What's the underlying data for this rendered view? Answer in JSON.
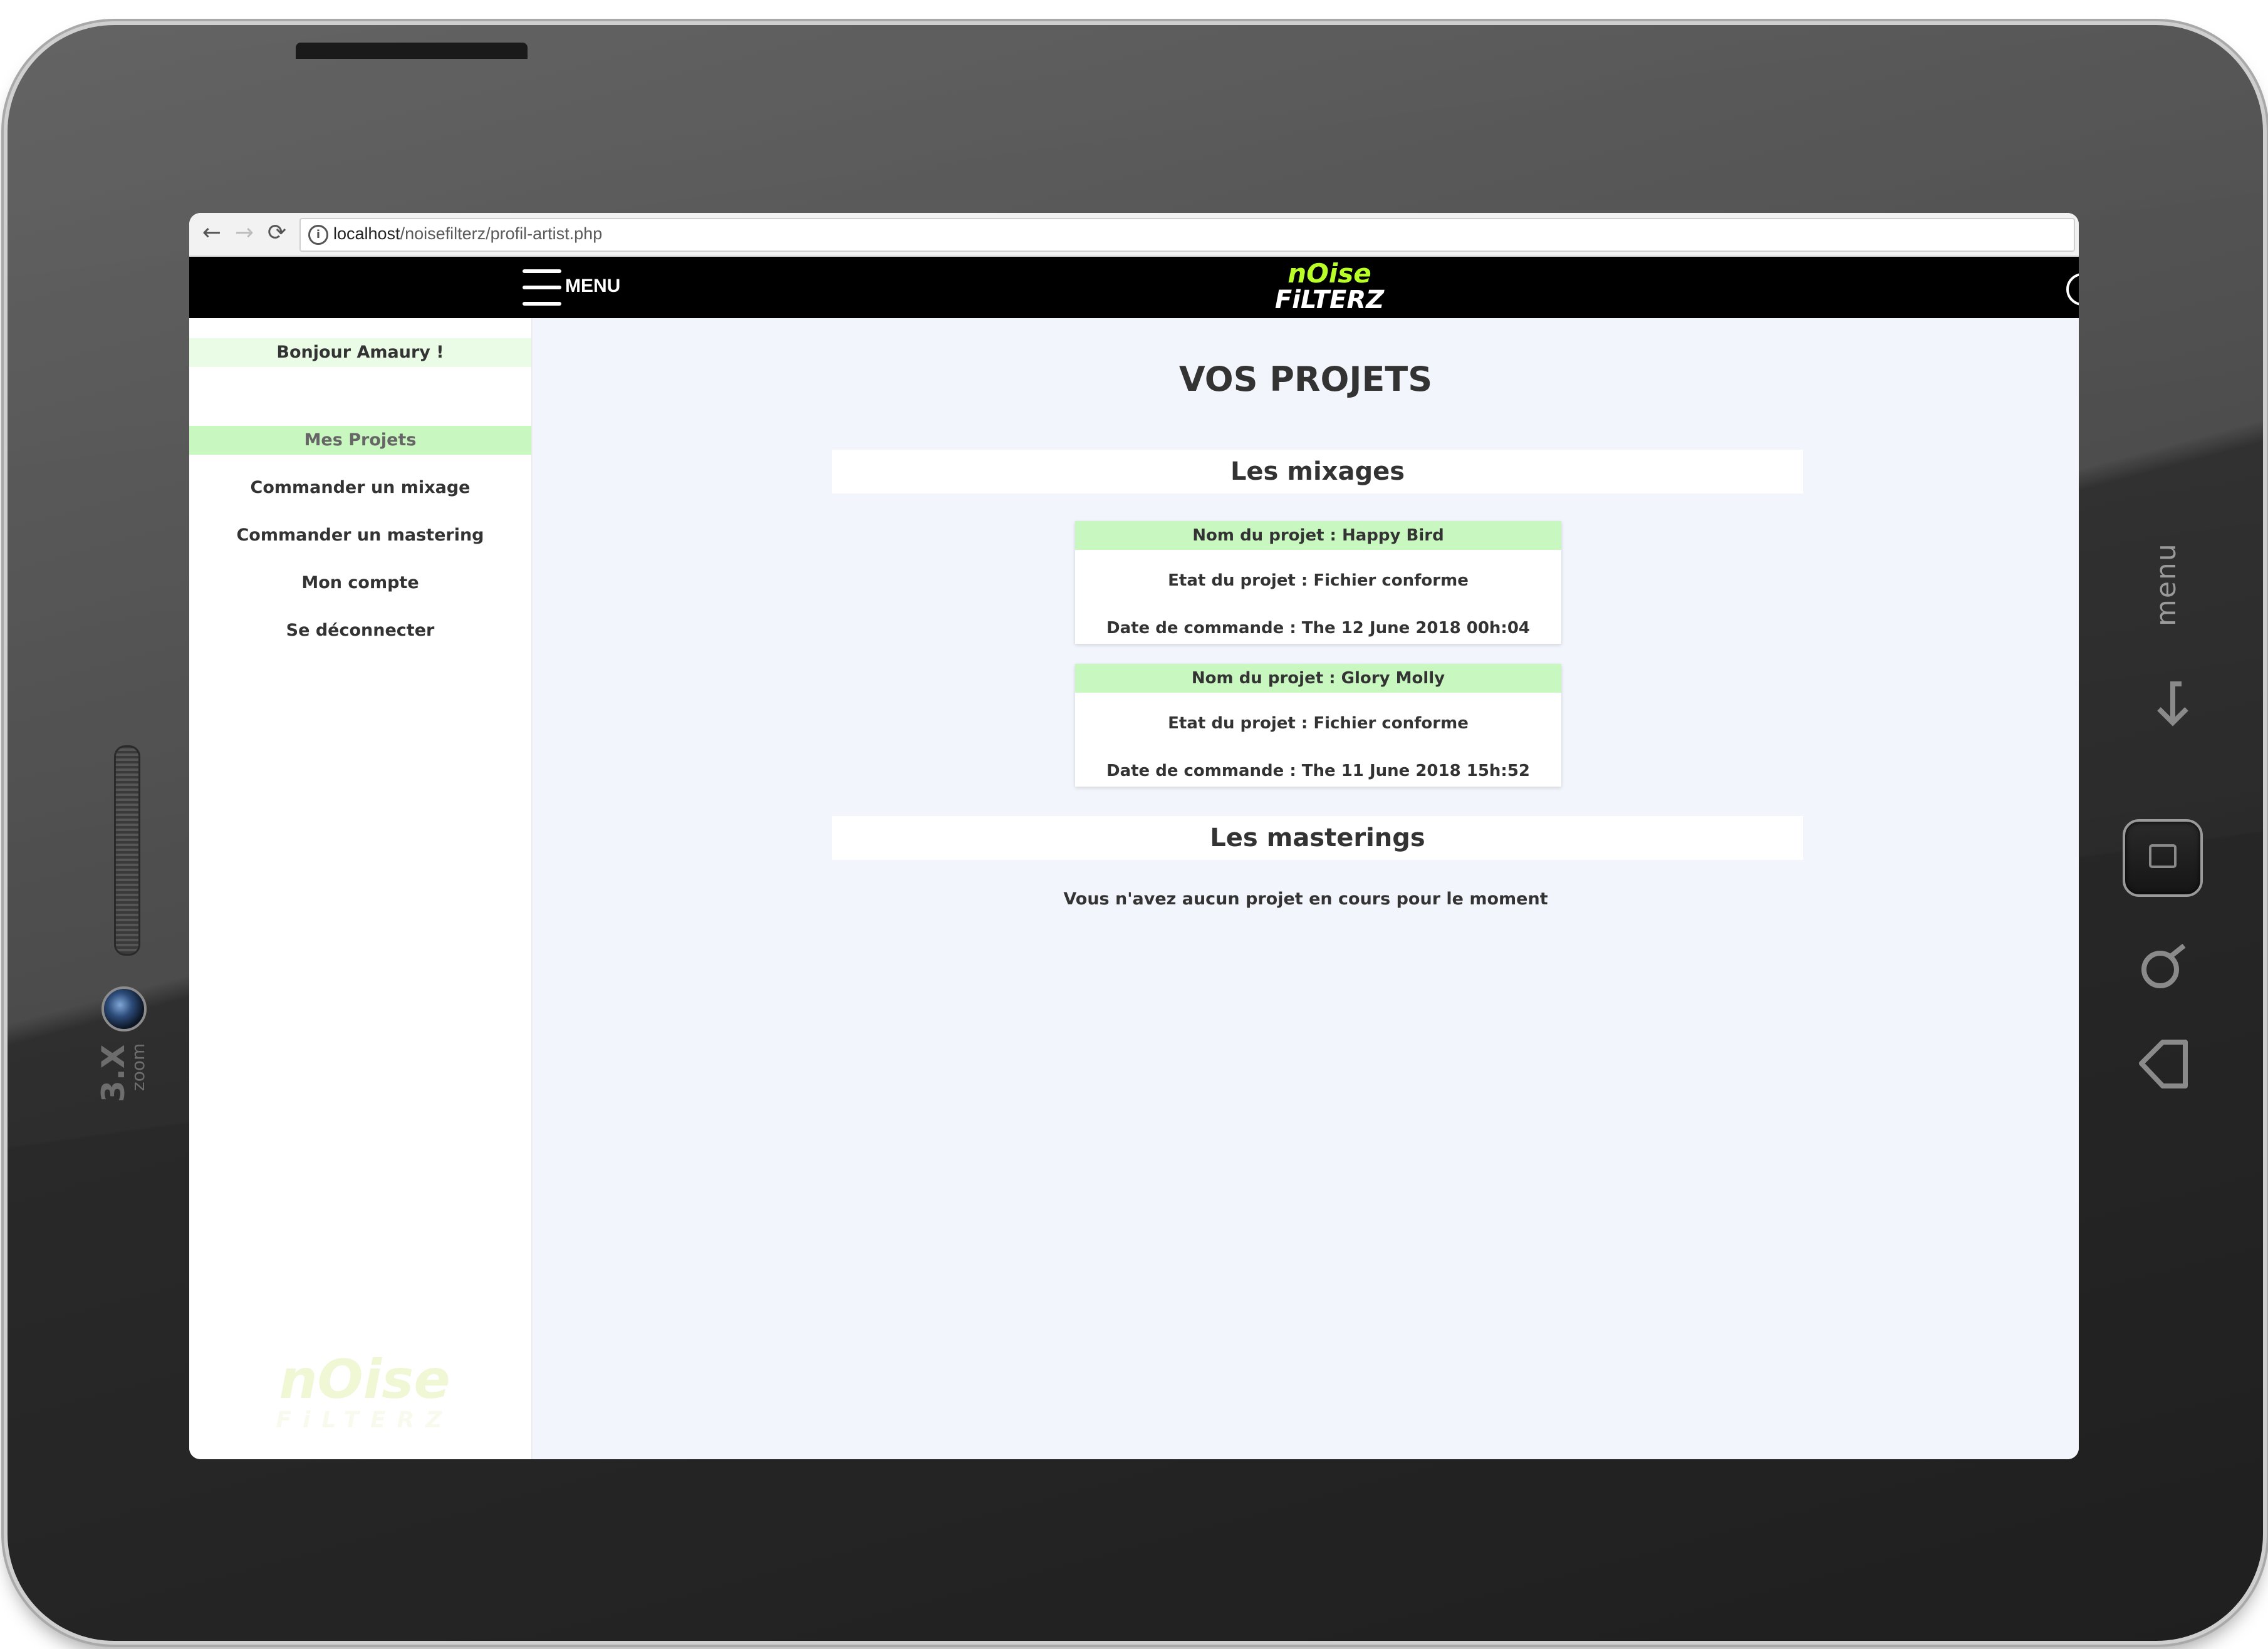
{
  "device": {
    "zoom_label": "3.X",
    "zoom_sub": "zoom",
    "side_menu_label": "menu"
  },
  "browser": {
    "url_host": "localhost",
    "url_path": "/noisefilterz/profil-artist.php"
  },
  "topnav": {
    "menu_label": "MENU",
    "logo_line1": "nOise",
    "logo_line2": "FiLTERZ"
  },
  "sidebar": {
    "greeting": "Bonjour Amaury !",
    "items": [
      {
        "label": "Mes Projets",
        "active": true
      },
      {
        "label": "Commander un mixage",
        "active": false
      },
      {
        "label": "Commander un mastering",
        "active": false
      },
      {
        "label": "Mon compte",
        "active": false
      },
      {
        "label": "Se déconnecter",
        "active": false
      }
    ],
    "logo_line1": "nOise",
    "logo_line2": "FiLTERZ"
  },
  "main": {
    "title": "VOS PROJETS",
    "mixages": {
      "heading": "Les mixages",
      "projects": [
        {
          "name": "Nom du projet : Happy Bird",
          "state": "Etat du projet : Fichier conforme",
          "date": "Date de commande : The 12 June 2018 00h:04"
        },
        {
          "name": "Nom du projet : Glory Molly",
          "state": "Etat du projet : Fichier conforme",
          "date": "Date de commande : The 11 June 2018 15h:52"
        }
      ]
    },
    "masterings": {
      "heading": "Les masterings",
      "empty_message": "Vous n'avez aucun projet en cours pour le moment"
    }
  },
  "colors": {
    "accent_green": "#c8f8bf",
    "logo_green": "#b9ff27",
    "nav_bg": "#000000",
    "main_bg": "#f2f6fc"
  }
}
